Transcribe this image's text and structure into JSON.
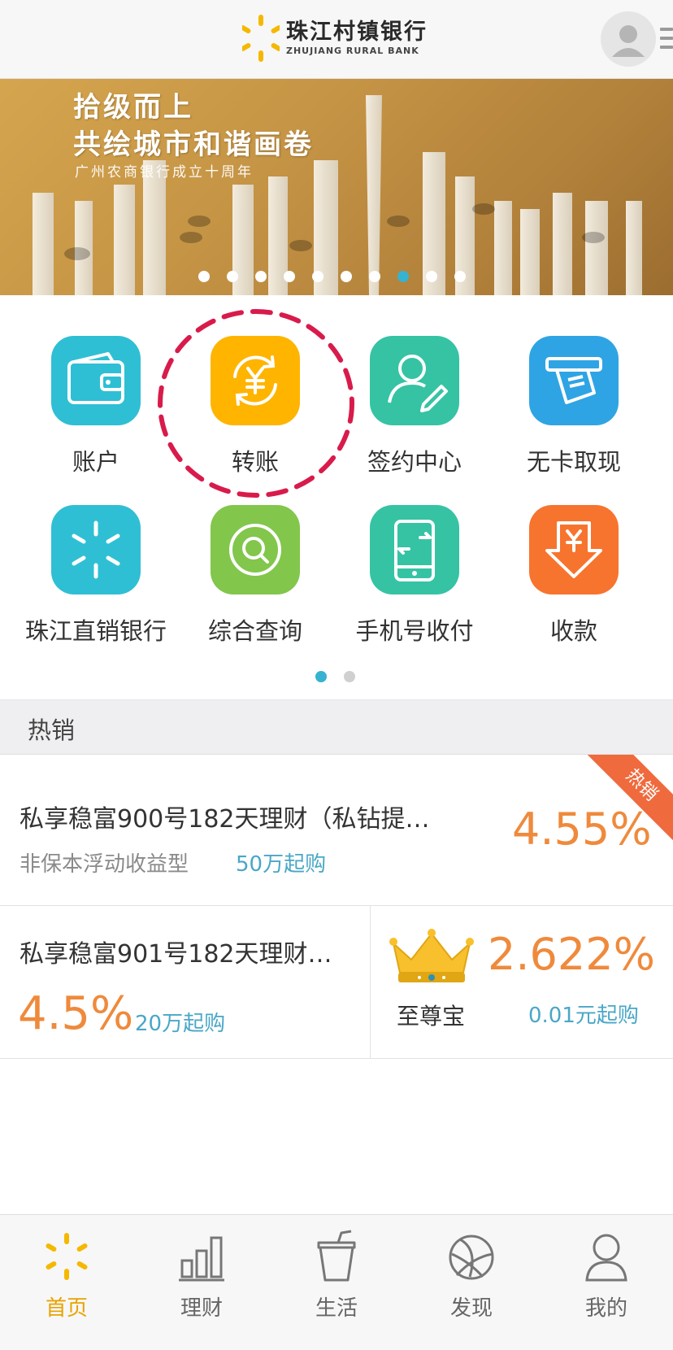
{
  "header": {
    "brand_cn": "珠江村镇银行",
    "brand_en": "ZHUJIANG RURAL BANK",
    "avatar_icon": "user-avatar-icon",
    "menu_icon": "menu-icon"
  },
  "banner": {
    "title_line1": "拾级而上",
    "title_line2": "共绘城市和谐画卷",
    "subtitle": "广州农商银行成立十周年",
    "slide_count": 10,
    "active_slide": 8
  },
  "grid": {
    "items": [
      {
        "label": "账户",
        "icon": "wallet-icon",
        "color": "#2fbfd4"
      },
      {
        "label": "转账",
        "icon": "yuan-transfer-icon",
        "color": "#ffb400"
      },
      {
        "label": "签约中心",
        "icon": "person-sign-icon",
        "color": "#35c3a4"
      },
      {
        "label": "无卡取现",
        "icon": "cash-withdraw-icon",
        "color": "#2fa4e4"
      },
      {
        "label": "珠江直销银行",
        "icon": "zhujiang-logo-icon",
        "color": "#2fbfd4"
      },
      {
        "label": "综合查询",
        "icon": "search-icon",
        "color": "#82c64c"
      },
      {
        "label": "手机号收付",
        "icon": "phone-transfer-icon",
        "color": "#35c3a4"
      },
      {
        "label": "收款",
        "icon": "receive-money-icon",
        "color": "#f7742e"
      }
    ],
    "page_count": 2,
    "active_page": 1
  },
  "section": {
    "title": "热销"
  },
  "products": {
    "featured": {
      "name": "私享稳富900号182天理财（私钻提…",
      "type": "非保本浮动收益型",
      "min_purchase": "50万起购",
      "rate": "4.55%",
      "badge": "热销"
    },
    "left": {
      "name": "私享稳富901号182天理财…",
      "rate": "4.5%",
      "min_purchase": "20万起购"
    },
    "right": {
      "icon": "crown-icon",
      "name": "至尊宝",
      "rate": "2.622%",
      "min_purchase": "0.01元起购"
    }
  },
  "tabbar": {
    "tabs": [
      {
        "label": "首页",
        "icon": "home-logo-icon",
        "active": true
      },
      {
        "label": "理财",
        "icon": "bar-chart-icon",
        "active": false
      },
      {
        "label": "生活",
        "icon": "drink-cup-icon",
        "active": false
      },
      {
        "label": "发现",
        "icon": "discover-icon",
        "active": false
      },
      {
        "label": "我的",
        "icon": "person-icon",
        "active": false
      }
    ]
  },
  "colors": {
    "accent": "#36b3d0",
    "rate_orange": "#ef8a3c",
    "brand_yellow": "#f5b800",
    "tab_active": "#e8a300",
    "circle_mark": "#d81b4b"
  }
}
